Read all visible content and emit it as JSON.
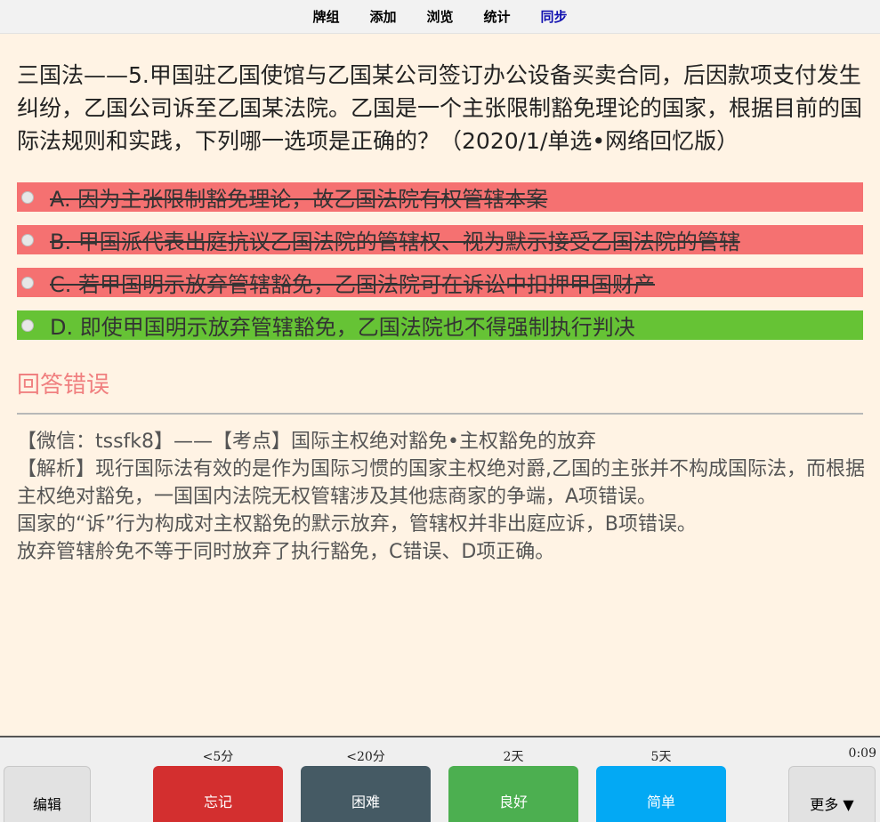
{
  "nav": {
    "items": [
      "牌组",
      "添加",
      "浏览",
      "统计",
      "同步"
    ]
  },
  "question": "三国法——5.甲国驻乙国使馆与乙国某公司签订办公设备买卖合同，后因款项支付发生纠纷，乙国公司诉至乙国某法院。乙国是一个主张限制豁免理论的国家，根据目前的国际法规则和实践，下列哪一选项是正确的？（2020/1/单选•网络回忆版）",
  "options": [
    {
      "text": "A. 因为主张限制豁免理论，故乙国法院有权管辖本案",
      "status": "wrong"
    },
    {
      "text": "B. 甲国派代表出庭抗议乙国法院的管辖权、视为默示接受乙国法院的管辖",
      "status": "wrong"
    },
    {
      "text": "C. 若甲国明示放弃管辖豁免，乙国法院可在诉讼中扣押甲国财产",
      "status": "wrong"
    },
    {
      "text": "D. 即使甲国明示放弃管辖豁免，乙国法院也不得强制执行判决",
      "status": "correct"
    }
  ],
  "result": "回答错误",
  "explanation": [
    "【微信：tssfk8】——【考点】国际主权绝对豁免•主权豁免的放弃",
    "【解析】现行国际法有效的是作为国际习惯的国家主权绝对爵,乙国的主张并不构成国际法，而根据主权绝对豁免，一国国内法院无权管辖涉及其他痣商家的争端，A项错误。",
    "国家的“诉”行为构成对主权豁免的默示放弃，管辖权并非出庭应诉，B项错误。",
    "放弃管辖舲免不等于同时放弃了执行豁免，C错误、D项正确。"
  ],
  "bottom": {
    "edit_label": "编辑",
    "more_label": "更多 ▼",
    "timer": "0:09",
    "answers": [
      {
        "interval": "<5分",
        "label": "忘记",
        "color": "#d32f2f"
      },
      {
        "interval": "<20分",
        "label": "困难",
        "color": "#455a64"
      },
      {
        "interval": "2天",
        "label": "良好",
        "color": "#4caf50"
      },
      {
        "interval": "5天",
        "label": "简单",
        "color": "#03a9f4"
      }
    ]
  },
  "colors": {
    "background": "#fff3e4",
    "wrong_option": "#f57171",
    "correct_option": "#66c335",
    "result_text": "#f08080"
  }
}
